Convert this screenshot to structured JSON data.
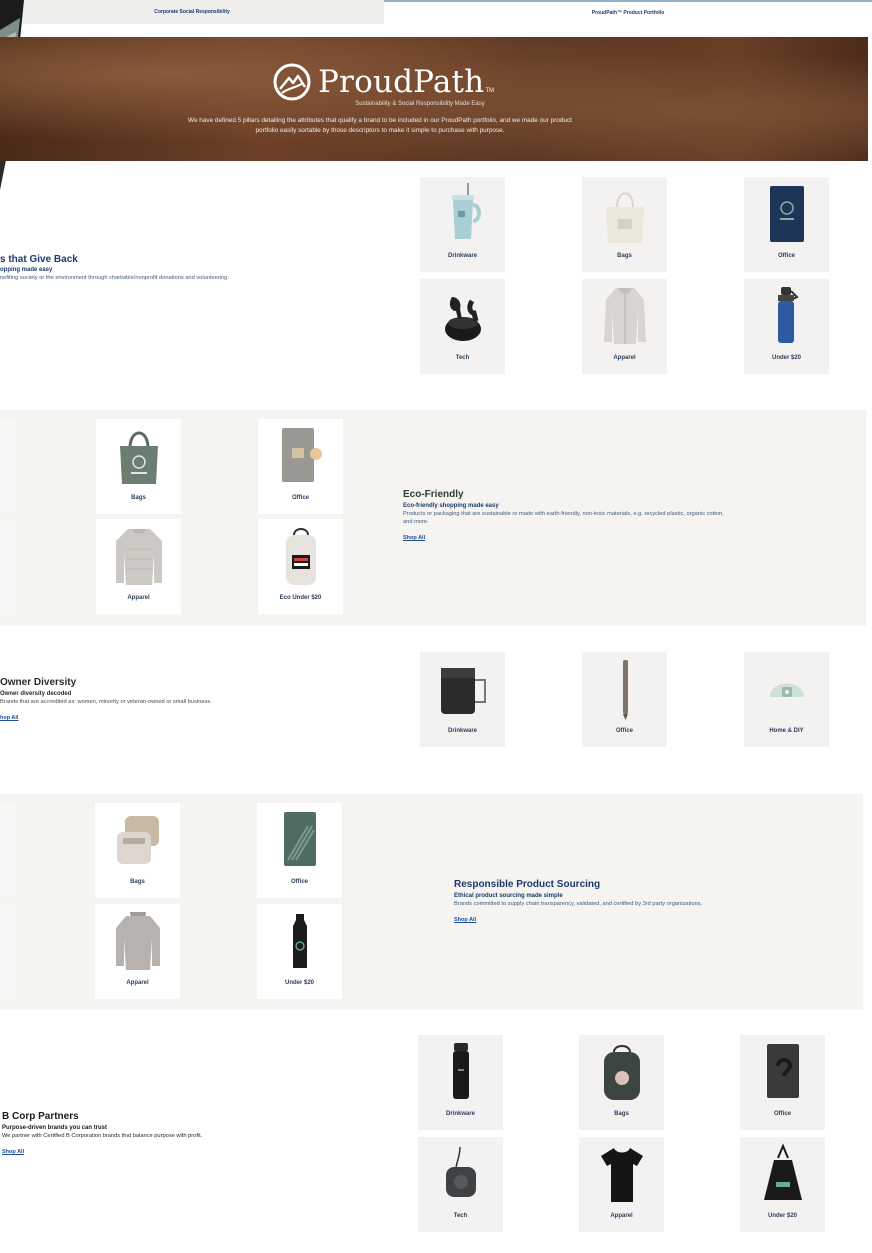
{
  "tabs": [
    {
      "label": "Corporate Social Responsibility"
    },
    {
      "label": "ProudPath™ Product Portfolio"
    }
  ],
  "hero": {
    "brand": "ProudPath",
    "trademark": "TM",
    "tagline": "Sustainability & Social Responsibility Made Easy",
    "description_line1": "We have defined 5 pillars detailing the attributes that qualify a brand to be included in our ProudPath portfolio, and we made our product",
    "description_line2": "portfolio easily sortable by those descriptors to make it simple to purchase with purpose."
  },
  "sections": {
    "give_back": {
      "title": "s that Give Back",
      "subtitle": "opping made easy",
      "description": "nefiting society or the environment through charitable/nonprofit donations and volunteering.",
      "tiles": [
        "Drinkware",
        "Bags",
        "Office",
        "Tech",
        "Apparel",
        "Under $20"
      ]
    },
    "eco": {
      "title": "Eco-Friendly",
      "subtitle": "Eco-friendly shopping made easy",
      "description_line1": "Products or packaging that are sustainable or made with earth-friendly, non-toxic materials, e.g. recycled plastic, organic cotton,",
      "description_line2": "and more.",
      "shop_all": "Shop All",
      "tiles": [
        "Bags",
        "Office",
        "Apparel",
        "Eco Under $20"
      ]
    },
    "diversity": {
      "title": "Owner Diversity",
      "subtitle": "Owner diversity decoded",
      "description": "Brands that are accredited as: women, minority or veteran-owned or small business.",
      "shop_all": "hop All",
      "tiles": [
        "Drinkware",
        "Office",
        "Home & DIY"
      ]
    },
    "sourcing": {
      "title": "Responsible Product Sourcing",
      "subtitle": "Ethical product sourcing made simple",
      "description": "Brands committed to supply chain transparency, validated, and certified by 3rd party organizations.",
      "shop_all": "Shop All",
      "tiles": [
        "Bags",
        "Office",
        "Apparel",
        "Under $20"
      ]
    },
    "bcorp": {
      "title": "B Corp Partners",
      "subtitle": "Purpose-driven brands you can trust",
      "description": "We partner with Certified B Corporation brands that balance purpose with profit.",
      "shop_all": "Shop All",
      "tiles": [
        "Drinkware",
        "Bags",
        "Office",
        "Tech",
        "Apparel",
        "Under $20"
      ]
    }
  },
  "colors": {
    "navy": "#1b3a6b",
    "band": "#f5f4f1",
    "tile": "#f3f2f0",
    "hero_brown": "#5a3420"
  }
}
